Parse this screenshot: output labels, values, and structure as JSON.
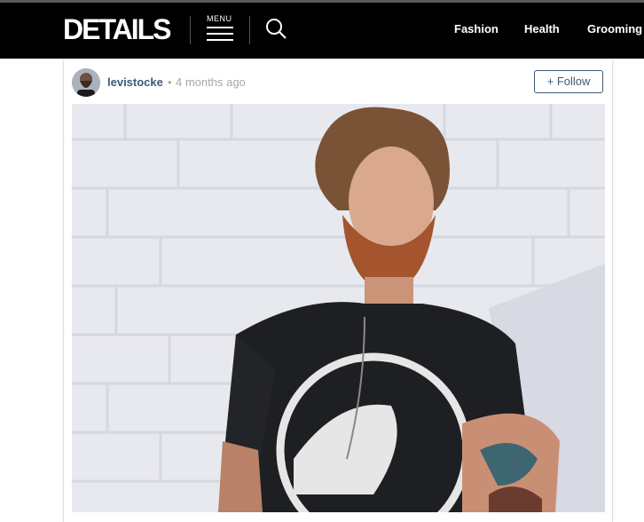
{
  "header": {
    "logo": "DETAILS",
    "menu_label": "MENU",
    "nav": [
      "Fashion",
      "Health",
      "Grooming"
    ]
  },
  "post": {
    "username": "levistocke",
    "separator": "•",
    "time": "4 months ago",
    "follow_label": "+ Follow"
  },
  "colors": {
    "header_bg": "#000000",
    "link_blue": "#3c5a78",
    "muted": "#a8a8a8"
  }
}
